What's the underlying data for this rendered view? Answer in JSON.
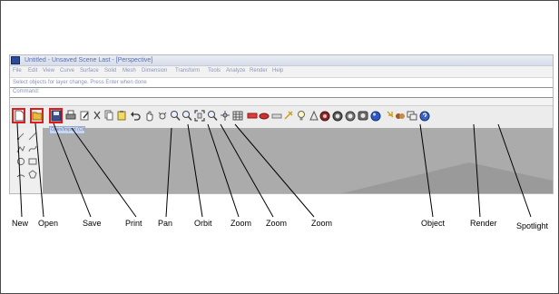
{
  "window": {
    "title": "Untitled - Unsaved Scene Last - [Perspective]",
    "app_icon": "rhino-app-icon"
  },
  "menubar": {
    "items": [
      "File",
      "Edit",
      "View",
      "Curve",
      "Surface",
      "Solid",
      "Mesh",
      "Dimension",
      "Transform",
      "Tools",
      "Analyze",
      "Render",
      "Help"
    ]
  },
  "command": {
    "history": "Select objects for layer change. Press Enter when done",
    "prompt": "Command:"
  },
  "toolbar": {
    "tooltip": "Open/Import (Ctrl+O)",
    "icons": [
      "new-icon",
      "open-icon",
      "save-icon",
      "print-icon",
      "properties-icon",
      "cut-icon",
      "copy-icon",
      "paste-icon",
      "undo-icon",
      "pan-icon",
      "rotate-icon",
      "zoom-in-icon",
      "zoom-window-icon",
      "zoom-extents-icon",
      "zoom-selected-icon",
      "named-views-icon",
      "grid-icon",
      "select-icon",
      "layer-icon",
      "lights-icon",
      "material-icon",
      "bulb-icon",
      "render-preview-icon",
      "object-snap-icon",
      "rebuild-icon",
      "shaded-sphere-icon",
      "object-properties-icon",
      "render-sphere-icon",
      "spotlight-icon",
      "toggle-icon",
      "help-icon"
    ]
  },
  "callouts": {
    "labels": [
      "New",
      "Open",
      "Save",
      "Print",
      "Pan",
      "Orbit",
      "Zoom",
      "Zoom",
      "Zoom",
      "Object",
      "Render",
      "Spotlight"
    ]
  },
  "colors": {
    "highlight": "#e11b1b",
    "viewport": "#a9a9a9",
    "title_text": "#5a6fae"
  }
}
